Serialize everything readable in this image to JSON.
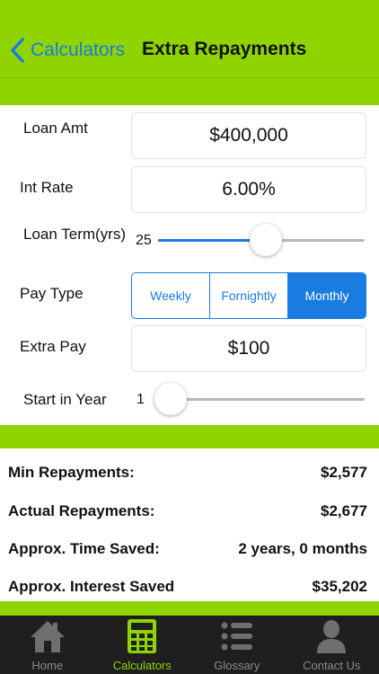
{
  "nav": {
    "back_label": "Calculators",
    "title": "Extra Repayments"
  },
  "form": {
    "loan_amount": {
      "label": "Loan Amt",
      "value": "$400,000"
    },
    "interest_rate": {
      "label": "Int Rate",
      "value": "6.00%"
    },
    "loan_term": {
      "label": "Loan Term(yrs)",
      "value": "25",
      "slider_fraction": 0.52
    },
    "pay_type": {
      "label": "Pay Type",
      "options": [
        "Weekly",
        "Fornightly",
        "Monthly"
      ],
      "selected": "Monthly"
    },
    "extra_pay": {
      "label": "Extra Pay",
      "value": "$100"
    },
    "start_year": {
      "label": "Start in Year",
      "value": "1",
      "slider_fraction": 0.0
    }
  },
  "results": [
    {
      "label": "Min Repayments:",
      "value": "$2,577"
    },
    {
      "label": "Actual Repayments:",
      "value": "$2,677"
    },
    {
      "label": "Approx. Time Saved:",
      "value": "2 years, 0 months"
    },
    {
      "label": "Approx. Interest Saved",
      "value": "$35,202"
    }
  ],
  "tabs": [
    {
      "label": "Home",
      "icon": "home-icon"
    },
    {
      "label": "Calculators",
      "icon": "calculator-icon",
      "active": true
    },
    {
      "label": "Glossary",
      "icon": "list-icon"
    },
    {
      "label": "Contact Us",
      "icon": "person-icon"
    }
  ],
  "colors": {
    "brand_green": "#8fd400",
    "accent_blue": "#1a7ce0",
    "tabbar_bg": "#1f1f1f"
  }
}
